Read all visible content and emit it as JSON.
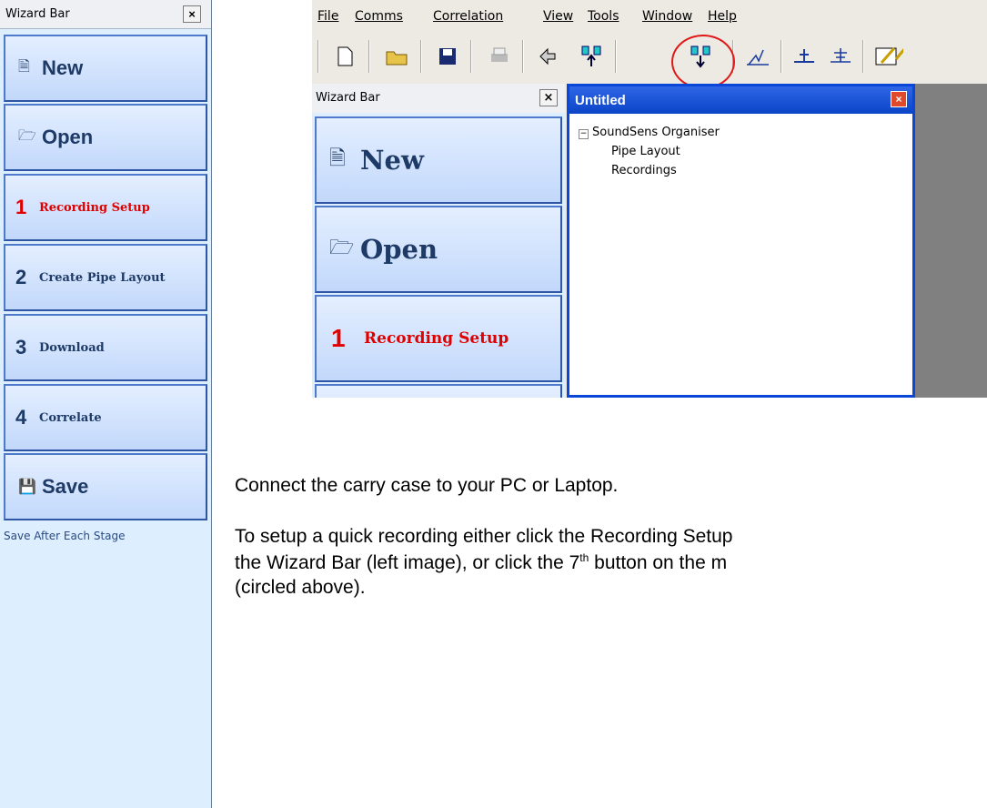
{
  "left_wizard": {
    "title": "Wizard Bar",
    "close": "×",
    "new": "New",
    "open": "Open",
    "steps": [
      {
        "num": "1",
        "label": "Recording Setup"
      },
      {
        "num": "2",
        "label": "Create Pipe Layout"
      },
      {
        "num": "3",
        "label": "Download"
      },
      {
        "num": "4",
        "label": "Correlate"
      }
    ],
    "save": "Save",
    "note": "Save After Each Stage"
  },
  "app": {
    "menu": [
      "File",
      "Comms",
      "Correlation",
      "View",
      "Tools",
      "Window",
      "Help"
    ],
    "toolbar_icons": [
      "new-file-icon",
      "open-folder-icon",
      "save-disk-icon",
      "print-icon",
      "comms-icon",
      "upload-icon",
      "download-icon",
      "correlate-icon",
      "pipe-icon",
      "layout-icon",
      "edit-icon"
    ],
    "wizard": {
      "title": "Wizard Bar",
      "close": "×",
      "new": "New",
      "open": "Open",
      "step1_num": "1",
      "step1_label": "Recording Setup"
    },
    "child_window": {
      "title": "Untitled",
      "close": "×",
      "tree": {
        "root": "SoundSens Organiser",
        "children": [
          "Pipe Layout",
          "Recordings"
        ]
      }
    }
  },
  "text": {
    "line1": "Connect the carry case to your PC or Laptop.",
    "line2": "To setup a quick recording either click the Recording Setup",
    "line3_a": "the Wizard Bar (left image), or click the 7",
    "line3_sup": "th",
    "line3_b": " button on the m",
    "line4": "(circled above)."
  }
}
